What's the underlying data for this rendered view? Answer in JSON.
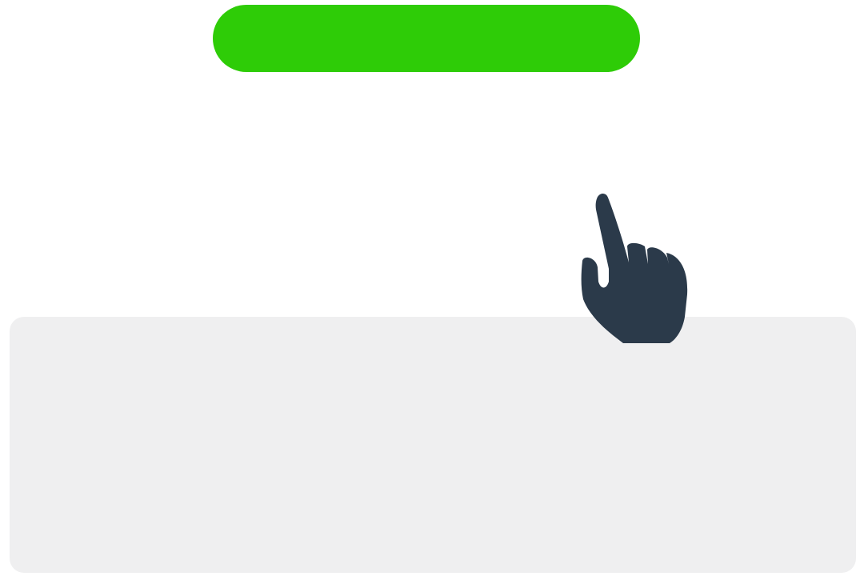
{
  "primary_button": {
    "label": "",
    "color": "#2ecc07"
  },
  "content_panel": {
    "color": "#efeff0"
  },
  "cursor": {
    "icon": "pointing-hand-icon",
    "color": "#2b3a4a"
  }
}
